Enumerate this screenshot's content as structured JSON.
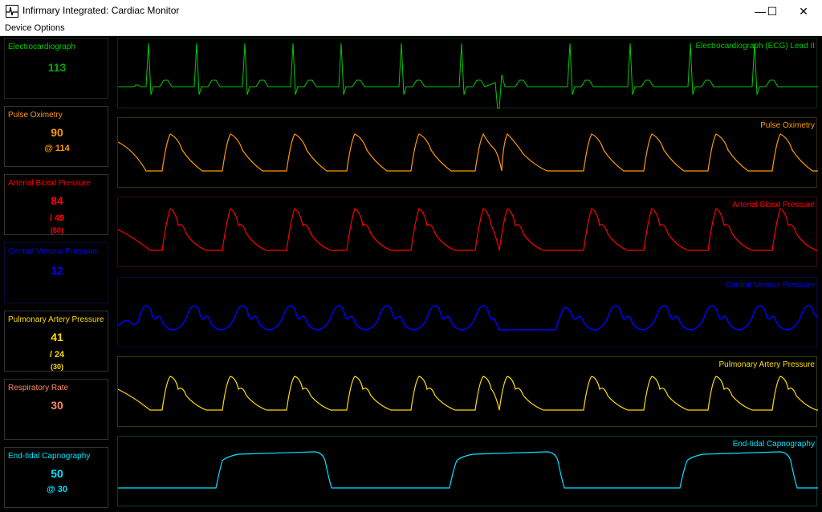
{
  "window": {
    "title": "Infirmary Integrated: Cardiac Monitor",
    "controls": {
      "minimize": "—",
      "maximize": "☐",
      "close": "✕"
    }
  },
  "menu": {
    "device_options": "Device Options"
  },
  "colors": {
    "ecg": "#00cc00",
    "spo2": "#ff9900",
    "abp": "#ff0000",
    "cvp": "#0000ff",
    "pa": "#ffdd00",
    "rr": "#ff8866",
    "etco2": "#00e5ff"
  },
  "panels": {
    "ecg": {
      "name": "Electrocardiograph",
      "value": "113"
    },
    "spo2": {
      "name": "Pulse Oximetry",
      "value": "90",
      "sub": "@ 114"
    },
    "abp": {
      "name": "Arterial Blood Pressure",
      "value": "84",
      "sub": "/ 49",
      "mean": "(60)"
    },
    "cvp": {
      "name": "Central Venous Pressure",
      "value": "12"
    },
    "pa": {
      "name": "Pulmonary Artery Pressure",
      "value": "41",
      "sub": "/ 24",
      "mean": "(30)"
    },
    "rr": {
      "name": "Respiratory Rate",
      "value": "30"
    },
    "etco2": {
      "name": "End-tidal Capnography",
      "value": "50",
      "sub": "@ 30"
    }
  },
  "traces": {
    "ecg": "Electrocardiograph (ECG) Lead II",
    "spo2": "Pulse Oximetry",
    "abp": "Arterial Blood Pressure",
    "cvp": "Central Venous Pressure",
    "pa": "Pulmonary Artery Pressure",
    "etco2": "End-tidal Capnography"
  }
}
